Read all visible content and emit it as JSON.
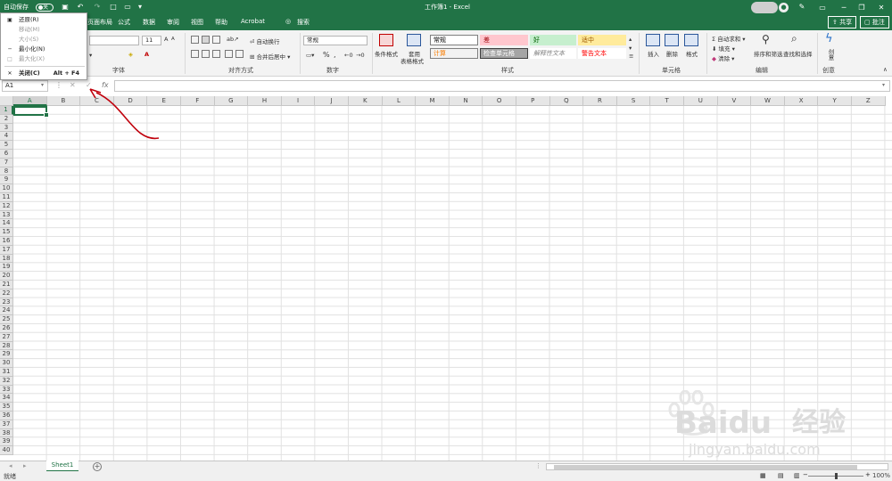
{
  "titlebar": {
    "autosave_label": "自动保存",
    "autosave_state": "关",
    "doc_title": "工作簿1 - Excel",
    "quick_access": [
      "save-icon",
      "undo-icon",
      "redo-icon",
      "new-icon",
      "open-icon",
      "customize-icon"
    ]
  },
  "tabs": [
    "页面布局",
    "公式",
    "数据",
    "审阅",
    "视图",
    "帮助",
    "Acrobat"
  ],
  "search_label": "搜索",
  "share_label": "共享",
  "comment_label": "批注",
  "system_menu": {
    "items": [
      {
        "label": "还原(R)",
        "enabled": true,
        "icon": "restore-icon"
      },
      {
        "label": "移动(M)",
        "enabled": false,
        "icon": ""
      },
      {
        "label": "大小(S)",
        "enabled": false,
        "icon": ""
      },
      {
        "label": "最小化(N)",
        "enabled": true,
        "icon": "minimize-icon"
      },
      {
        "label": "最大化(X)",
        "enabled": false,
        "icon": "maximize-icon"
      },
      {
        "label": "关闭(C)",
        "shortcut": "Alt + F4",
        "enabled": true,
        "icon": "close-icon"
      }
    ]
  },
  "ribbon": {
    "font_size": "11",
    "font_group_label": "字体",
    "align_group_label": "对齐方式",
    "wrap_text": "自动换行",
    "merge_center": "合并后居中",
    "number_format": "常规",
    "number_group_label": "数字",
    "cond_format": "条件格式",
    "table_format_1": "套用",
    "table_format_2": "表格格式",
    "styles_group_label": "样式",
    "styles": [
      {
        "label": "常规",
        "color": "#000000",
        "bg": "#ffffff",
        "border": "#7f7f7f"
      },
      {
        "label": "差",
        "color": "#9c0006",
        "bg": "#ffc7ce",
        "border": ""
      },
      {
        "label": "好",
        "color": "#006100",
        "bg": "#c6efce",
        "border": ""
      },
      {
        "label": "适中",
        "color": "#9c5700",
        "bg": "#ffeb9c",
        "border": ""
      },
      {
        "label": "计算",
        "color": "#fa7d00",
        "bg": "#f2f2f2",
        "border": "#7f7f7f"
      },
      {
        "label": "检查单元格",
        "color": "#ffffff",
        "bg": "#a5a5a5",
        "border": "#3f3f3f"
      },
      {
        "label": "解释性文本",
        "color": "#7f7f7f",
        "bg": "#ffffff",
        "border": ""
      },
      {
        "label": "警告文本",
        "color": "#ff0000",
        "bg": "#ffffff",
        "border": ""
      }
    ],
    "insert": "插入",
    "delete": "删除",
    "format": "格式",
    "cells_group_label": "单元格",
    "autosum": "自动求和",
    "fill": "填充",
    "clear": "清除",
    "sort_filter": "排序和筛选",
    "find_select": "查找和选择",
    "editing_group_label": "编辑",
    "ideas": "创意",
    "ideas_sub": "创意"
  },
  "formula_bar": {
    "name_box": "A1",
    "fx_label": "fx"
  },
  "grid": {
    "columns": [
      "A",
      "B",
      "C",
      "D",
      "E",
      "F",
      "G",
      "H",
      "I",
      "J",
      "K",
      "L",
      "M",
      "N",
      "O",
      "P",
      "Q",
      "R",
      "S",
      "T",
      "U",
      "V",
      "W",
      "X",
      "Y",
      "Z"
    ],
    "rows": [
      "1",
      "2",
      "3",
      "4",
      "5",
      "6",
      "7",
      "8",
      "9",
      "10",
      "11",
      "12",
      "13",
      "14",
      "15",
      "16",
      "17",
      "18",
      "19",
      "20",
      "21",
      "22",
      "23",
      "24",
      "25",
      "26",
      "27",
      "28",
      "29",
      "30",
      "31",
      "32",
      "33",
      "34",
      "35",
      "36",
      "37",
      "38",
      "39",
      "40"
    ],
    "active_cell": "A1"
  },
  "sheets": [
    "Sheet1"
  ],
  "status": {
    "ready": "就绪",
    "zoom": "100%"
  },
  "watermark": {
    "brand": "Baidu",
    "brand2": "经验",
    "url": "jingyan.baidu.com"
  },
  "colors": {
    "accent": "#217346",
    "annotation": "#c0000c"
  }
}
